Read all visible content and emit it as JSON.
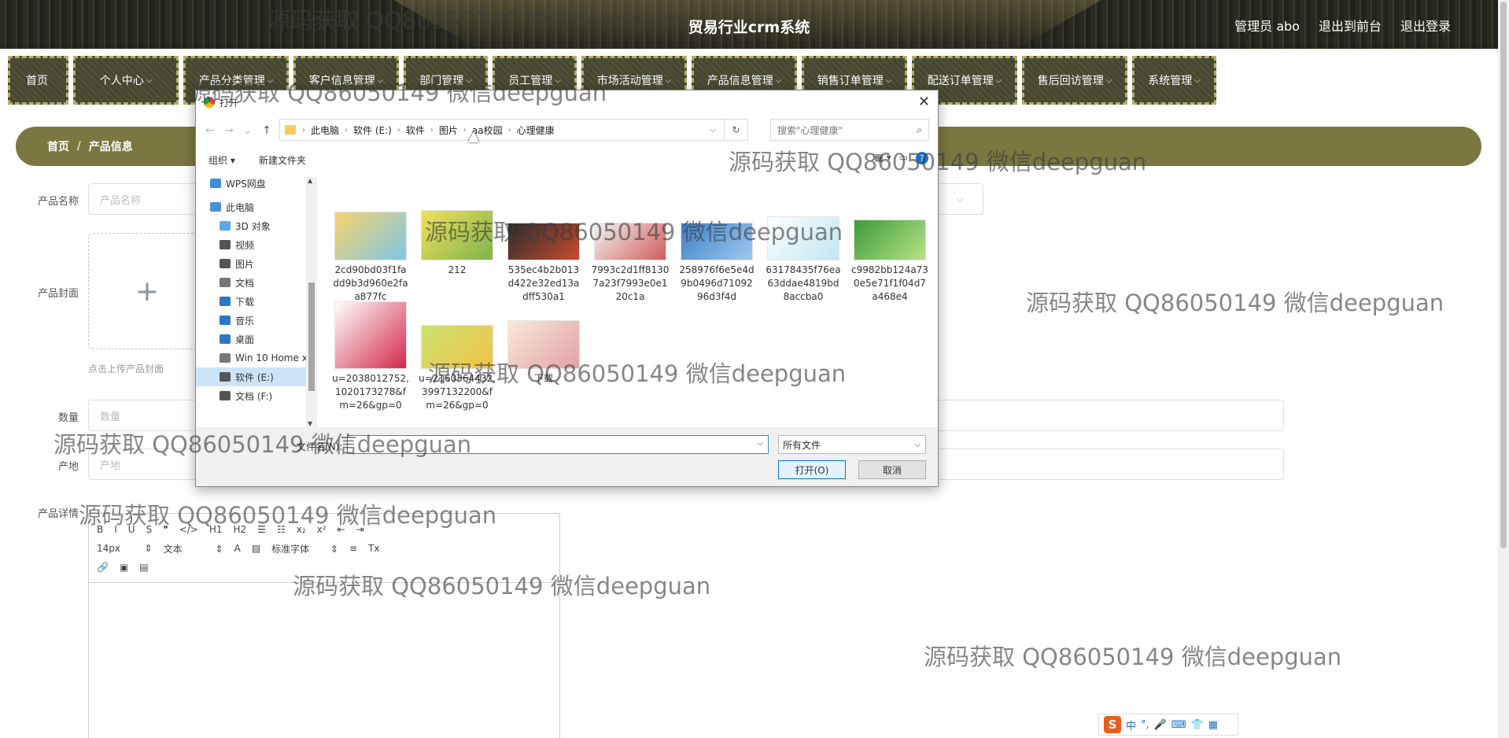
{
  "header": {
    "title": "贸易行业crm系统",
    "links": [
      "管理员 abo",
      "退出到前台",
      "退出登录"
    ]
  },
  "nav": [
    {
      "label": "首页",
      "arrow": ""
    },
    {
      "label": "个人中心",
      "arrow": "⌵"
    },
    {
      "label": "产品分类管理",
      "arrow": "⌵"
    },
    {
      "label": "客户信息管理",
      "arrow": "⌵"
    },
    {
      "label": "部门管理",
      "arrow": "⌵"
    },
    {
      "label": "员工管理",
      "arrow": "⌵"
    },
    {
      "label": "市场活动管理",
      "arrow": "⌵"
    },
    {
      "label": "产品信息管理",
      "arrow": "⌵"
    },
    {
      "label": "销售订单管理",
      "arrow": "⌵"
    },
    {
      "label": "配送订单管理",
      "arrow": "⌵"
    },
    {
      "label": "售后回访管理",
      "arrow": "⌵"
    },
    {
      "label": "系统管理",
      "arrow": "⌵"
    }
  ],
  "breadcrumb": {
    "home": "首页",
    "sep": "/",
    "current": "产品信息"
  },
  "form": {
    "name_label": "产品名称",
    "name_placeholder": "产品名称",
    "cover_label": "产品封面",
    "cover_plus": "+",
    "cover_hint": "点击上传产品封面",
    "qty_label": "数量",
    "qty_placeholder": "数量",
    "origin_label": "产地",
    "origin_placeholder": "产地",
    "detail_label": "产品详情",
    "select_arrow": "⌵"
  },
  "editor": {
    "row1": [
      "B",
      "I",
      "U",
      "S",
      "❞",
      "</>",
      "H1",
      "H2",
      "☰",
      "☷",
      "x₂",
      "x²",
      "⇤",
      "⇥"
    ],
    "font_size": "14px",
    "text_type": "文本",
    "font_family": "标准字体",
    "row2_icons": [
      "A",
      "▨",
      "≡",
      "Tx"
    ],
    "row3": [
      "🔗",
      "▣",
      "▤"
    ]
  },
  "dialog": {
    "title": "打开",
    "close": "✕",
    "nav": {
      "back": "←",
      "forward": "→",
      "recent": "⌄",
      "up": "↑"
    },
    "path": [
      "此电脑",
      "软件 (E:)",
      "软件",
      "图片",
      "aa校园",
      "心理健康"
    ],
    "path_sep": "›",
    "refresh": "↻",
    "search_placeholder": "搜索\"心理健康\"",
    "search_icon": "⌕",
    "organize": "组织 ▾",
    "new_folder": "新建文件夹",
    "view_icons": [
      "▦ ▾",
      "▭"
    ],
    "help": "?",
    "tree": [
      {
        "label": "WPS网盘",
        "color": "#3a8de0",
        "indent": 18
      },
      {
        "label": "此电脑",
        "color": "#4a90d9",
        "indent": 18
      },
      {
        "label": "3D 对象",
        "color": "#58a9e8",
        "indent": 30
      },
      {
        "label": "视频",
        "color": "#555555",
        "indent": 30
      },
      {
        "label": "图片",
        "color": "#555555",
        "indent": 30
      },
      {
        "label": "文档",
        "color": "#777777",
        "indent": 30
      },
      {
        "label": "下载",
        "color": "#2b78c5",
        "indent": 30
      },
      {
        "label": "音乐",
        "color": "#2b78c5",
        "indent": 30
      },
      {
        "label": "桌面",
        "color": "#2b78c5",
        "indent": 30
      },
      {
        "label": "Win 10 Home x",
        "color": "#777777",
        "indent": 30
      },
      {
        "label": "软件 (E:)",
        "color": "#555555",
        "indent": 30
      },
      {
        "label": "文档 (F:)",
        "color": "#555555",
        "indent": 30
      }
    ],
    "files": [
      {
        "name": "2cd90bd03f1fa dd9b3d960e2fa a877fc",
        "c1": "#f6d36b",
        "c2": "#7fc6e6"
      },
      {
        "name": "212",
        "c1": "#f1e05a",
        "c2": "#7fb34d"
      },
      {
        "name": "535ec4b2b013 d422e32ed13a dff530a1",
        "c1": "#2c2c2c",
        "c2": "#c84b2f"
      },
      {
        "name": "7993c2d1ff8130 7a23f7993e0e1 20c1a",
        "c1": "#f2f2f2",
        "c2": "#d25b5b"
      },
      {
        "name": "258976f6e5e4d 9b0496d71092 96d3f4d",
        "c1": "#3d7fc8",
        "c2": "#9ec9ef"
      },
      {
        "name": "63178435f76ea 63ddae4819bd 8accba0",
        "c1": "#ffffff",
        "c2": "#bfe5f0"
      },
      {
        "name": "c9982bb124a73 0e5e71f1f04d7 a468e4",
        "c1": "#3c9b37",
        "c2": "#b7e28a"
      },
      {
        "name": "u=2038012752, 1020173278&f m=26&gp=0",
        "c1": "#ffffff",
        "c2": "#d4284a"
      },
      {
        "name": "u=2160364432, 3997132200&f m=26&gp=0",
        "c1": "#cbe26e",
        "c2": "#f3c24a"
      },
      {
        "name": "下载",
        "c1": "#f8ead9",
        "c2": "#e3a0a8"
      }
    ],
    "filename_label": "文件名(N):",
    "filename_value": "",
    "filetype": "所有文件",
    "open_btn": "打开(O)",
    "cancel_btn": "取消"
  },
  "watermark": "源码获取 QQ86050149 微信deepguan",
  "ime": {
    "logo": "S",
    "items": [
      "中",
      "°,",
      "🎤",
      "⌨",
      "👕",
      "▦"
    ]
  }
}
